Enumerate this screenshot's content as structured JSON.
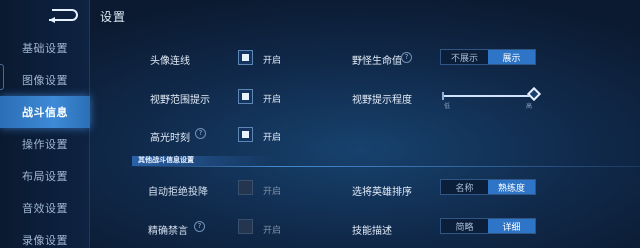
{
  "page": {
    "title": "设置"
  },
  "sidebar": {
    "items": [
      {
        "label": "基础设置",
        "active": false
      },
      {
        "label": "图像设置",
        "active": false
      },
      {
        "label": "战斗信息",
        "active": true
      },
      {
        "label": "操作设置",
        "active": false
      },
      {
        "label": "布局设置",
        "active": false
      },
      {
        "label": "音效设置",
        "active": false
      },
      {
        "label": "录像设置",
        "active": false
      }
    ]
  },
  "left_settings": {
    "portrait_link": {
      "label": "头像连线",
      "checked": true,
      "state_label": "开启"
    },
    "vision_hint": {
      "label": "视野范围提示",
      "checked": true,
      "state_label": "开启"
    },
    "highlight": {
      "label": "高光时刻",
      "checked": true,
      "state_label": "开启",
      "help_icon": "question-diamond-icon"
    }
  },
  "right_settings": {
    "monster_hp": {
      "label": "野怪生命值",
      "help_icon": "question-diamond-icon",
      "options": [
        "不展示",
        "展示"
      ],
      "selected": "展示"
    },
    "vision_level": {
      "label": "视野提示程度",
      "min_label": "低",
      "max_label": "高",
      "value": 1.0
    }
  },
  "other_section": {
    "title": "其他战斗信息设置",
    "auto_reject_surrender": {
      "label": "自动拒绝投降",
      "checked": false,
      "state_label": "开启"
    },
    "precise_mute": {
      "label": "精确禁言",
      "checked": false,
      "state_label": "开启",
      "help_icon": "question-diamond-icon"
    },
    "hero_sort": {
      "label": "选将英雄排序",
      "options": [
        "名称",
        "熟练度"
      ],
      "selected": "熟练度"
    },
    "skill_desc": {
      "label": "技能描述",
      "options": [
        "简略",
        "详细"
      ],
      "selected": "详细"
    }
  },
  "colors": {
    "accent": "#2e74c7",
    "active_tab": "#3e8ad6",
    "background": "#10294a"
  },
  "icons": {
    "back": "back-arrow-icon",
    "help": "question-diamond-icon"
  }
}
